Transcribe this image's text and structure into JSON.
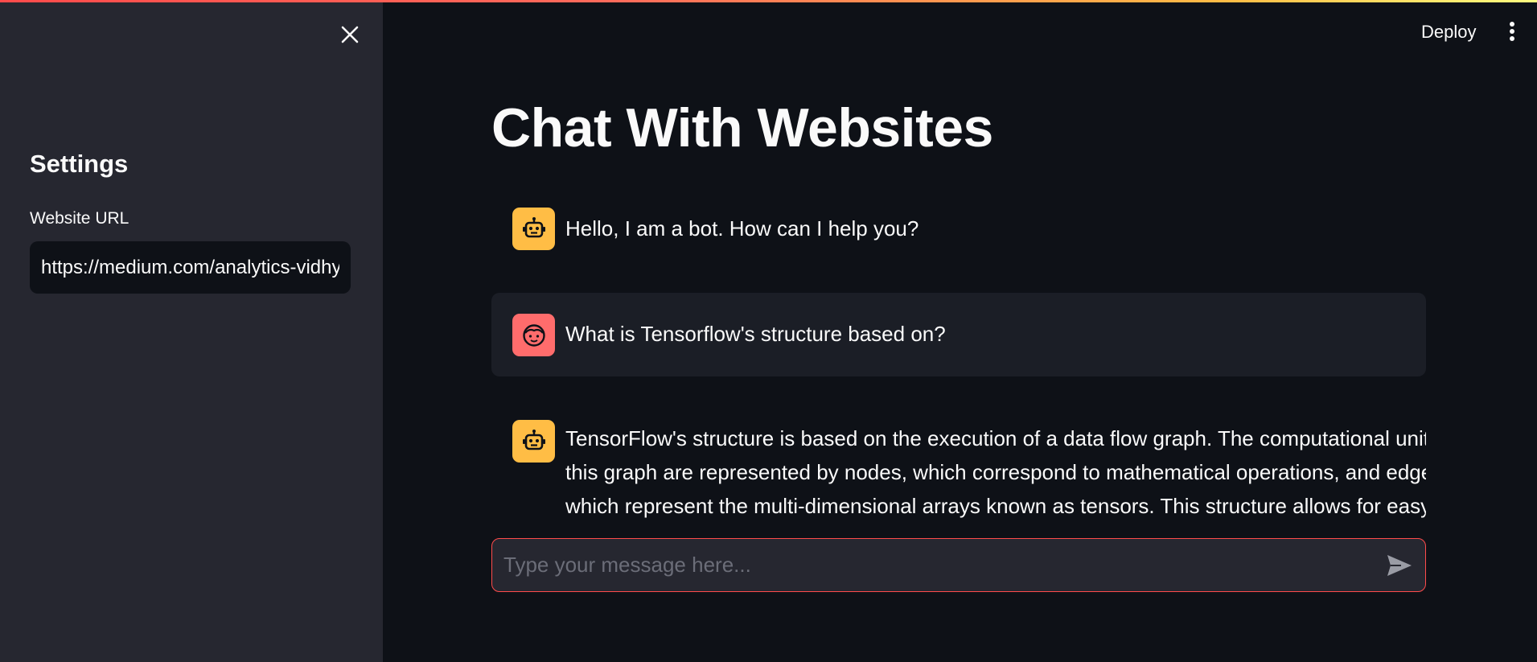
{
  "app": {
    "title": "Chat With Websites",
    "deploy_label": "Deploy"
  },
  "sidebar": {
    "title": "Settings",
    "url_label": "Website URL",
    "url_value": "https://medium.com/analytics-vidhya/"
  },
  "messages": [
    {
      "role": "bot",
      "avatar_icon": "robot-icon",
      "text": "Hello, I am a bot. How can I help you?"
    },
    {
      "role": "user",
      "avatar_icon": "face-icon",
      "text": "What is Tensorflow's structure based on?"
    },
    {
      "role": "bot",
      "avatar_icon": "robot-icon",
      "lines": [
        "TensorFlow's structure is based on the execution of a data flow graph. The computational units in",
        "this graph are represented by nodes, which correspond to mathematical operations, and edges,",
        "which represent the multi-dimensional arrays known as tensors. This structure allows for easy"
      ]
    }
  ],
  "chat_input": {
    "placeholder": "Type your message here..."
  },
  "colors": {
    "accent": "#ff4b4b",
    "bot_avatar": "#ffbd45",
    "user_avatar": "#ff6c6c",
    "sidebar_bg": "#262730",
    "main_bg": "#0e1117"
  }
}
